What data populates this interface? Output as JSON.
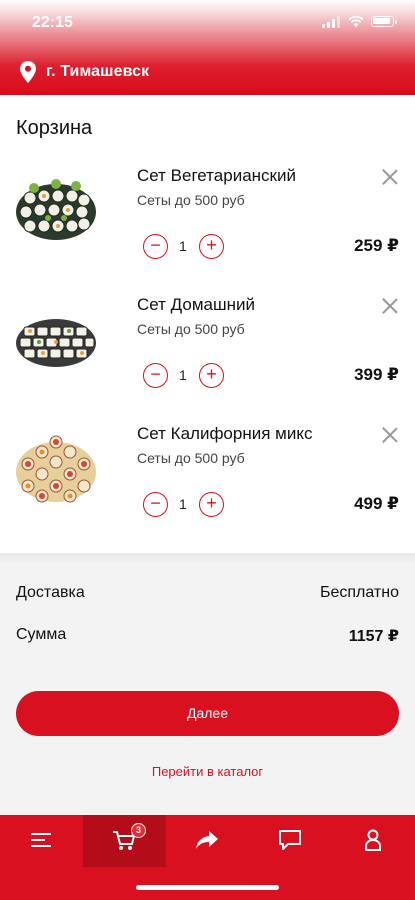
{
  "status_bar": {
    "time": "22:15"
  },
  "header": {
    "city": "г. Тимашевск",
    "pin_icon": "location-pin-icon"
  },
  "cart": {
    "title": "Корзина",
    "items": [
      {
        "name": "Сет Вегетарианский",
        "category": "Сеты до 500 руб",
        "quantity": "1",
        "price": "259 ₽"
      },
      {
        "name": "Сет Домашний",
        "category": "Сеты до 500 руб",
        "quantity": "1",
        "price": "399 ₽"
      },
      {
        "name": "Сет Калифорния микс",
        "category": "Сеты до 500 руб",
        "quantity": "1",
        "price": "499 ₽"
      }
    ]
  },
  "summary": {
    "delivery_label": "Доставка",
    "delivery_value": "Бесплатно",
    "total_label": "Сумма",
    "total_value": "1157 ₽"
  },
  "actions": {
    "next_label": "Далее",
    "catalog_link": "Перейти в каталог"
  },
  "tabbar": {
    "tabs": [
      {
        "icon": "menu-icon",
        "active": false
      },
      {
        "icon": "cart-icon",
        "active": true,
        "badge": "3"
      },
      {
        "icon": "share-icon",
        "active": false
      },
      {
        "icon": "chat-icon",
        "active": false
      },
      {
        "icon": "profile-icon",
        "active": false
      }
    ]
  },
  "colors": {
    "brand": "#d8101f",
    "panel": "#f3f3f3"
  }
}
